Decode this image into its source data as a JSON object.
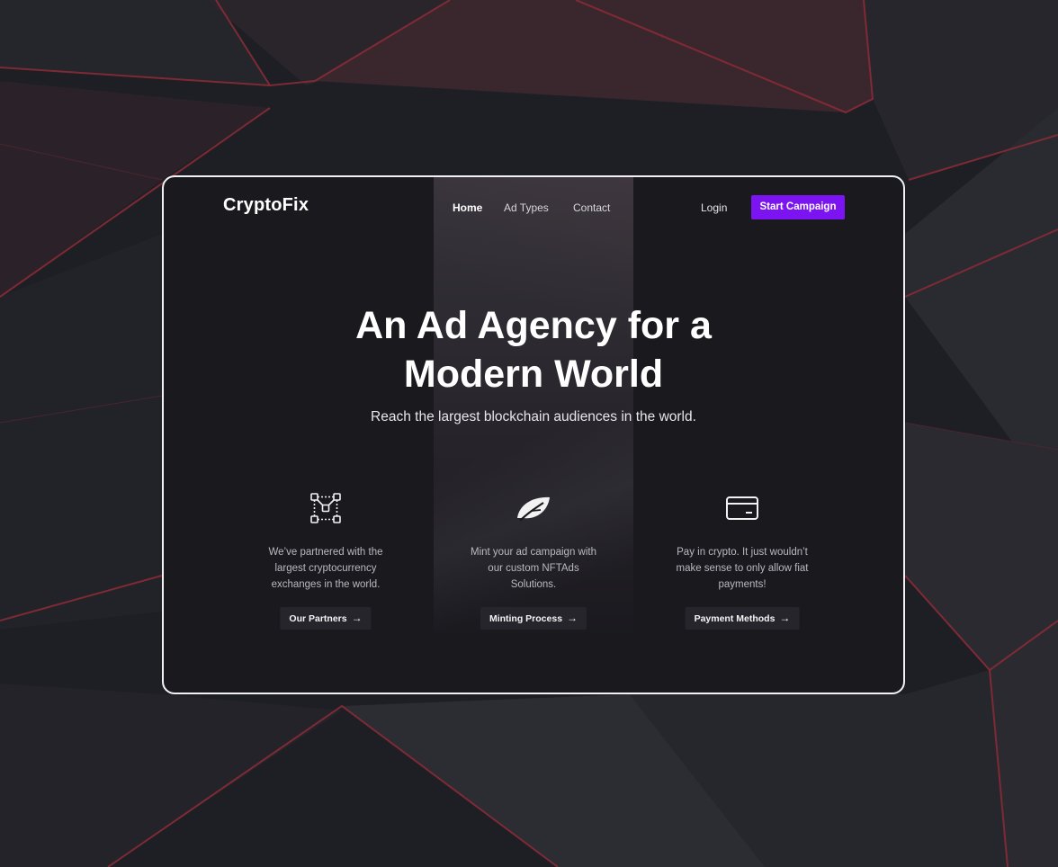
{
  "brand": {
    "logo": "CryptoFix",
    "accent": "#7b14f1"
  },
  "nav": {
    "items": [
      "Home",
      "Ad Types",
      "Contact"
    ],
    "active": "Home"
  },
  "auth": {
    "login": "Login",
    "start": "Start Campaign"
  },
  "hero": {
    "title_line1": "An Ad Agency for a",
    "title_line2": "Modern World",
    "subtitle": "Reach the largest blockchain audiences in the world."
  },
  "features": [
    {
      "icon": "network-nodes-icon",
      "line1": "We’ve partnered with the",
      "line2": "largest cryptocurrency",
      "line3": "exchanges in the world.",
      "cta": "Our Partners",
      "arrow": "→"
    },
    {
      "icon": "leaf-icon",
      "line1": "Mint your ad campaign with",
      "line2": "our custom NFTAds",
      "line3": "Solutions.",
      "cta": "Minting Process",
      "arrow": "→"
    },
    {
      "icon": "credit-card-icon",
      "line1": "Pay in crypto. It just wouldn’t",
      "line2": "make sense to only allow fiat",
      "line3": "payments!",
      "cta": "Payment Methods",
      "arrow": "→"
    }
  ]
}
